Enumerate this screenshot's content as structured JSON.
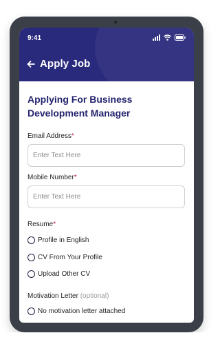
{
  "status_bar": {
    "time": "9:41"
  },
  "header": {
    "title": "Apply Job",
    "back_icon": "arrow-left-icon"
  },
  "form": {
    "heading": "Applying For Business Development Manager",
    "email": {
      "label": "Email Address",
      "required_mark": "*",
      "placeholder": "Enter Text Here"
    },
    "mobile": {
      "label": "Mobile Number",
      "required_mark": "*",
      "placeholder": "Enter Text Here"
    },
    "resume": {
      "label": "Resume",
      "required_mark": "*",
      "options": [
        "Profile in English",
        "CV From Your Profile",
        "Upload Other CV"
      ]
    },
    "motivation": {
      "label": "Motivation Letter",
      "optional_text": "(optional)",
      "options": [
        "No motivation letter attached"
      ]
    }
  },
  "colors": {
    "header": "#2a2a7c",
    "heading": "#23236e",
    "required": "#d0204a",
    "frame": "#3b3f47"
  }
}
